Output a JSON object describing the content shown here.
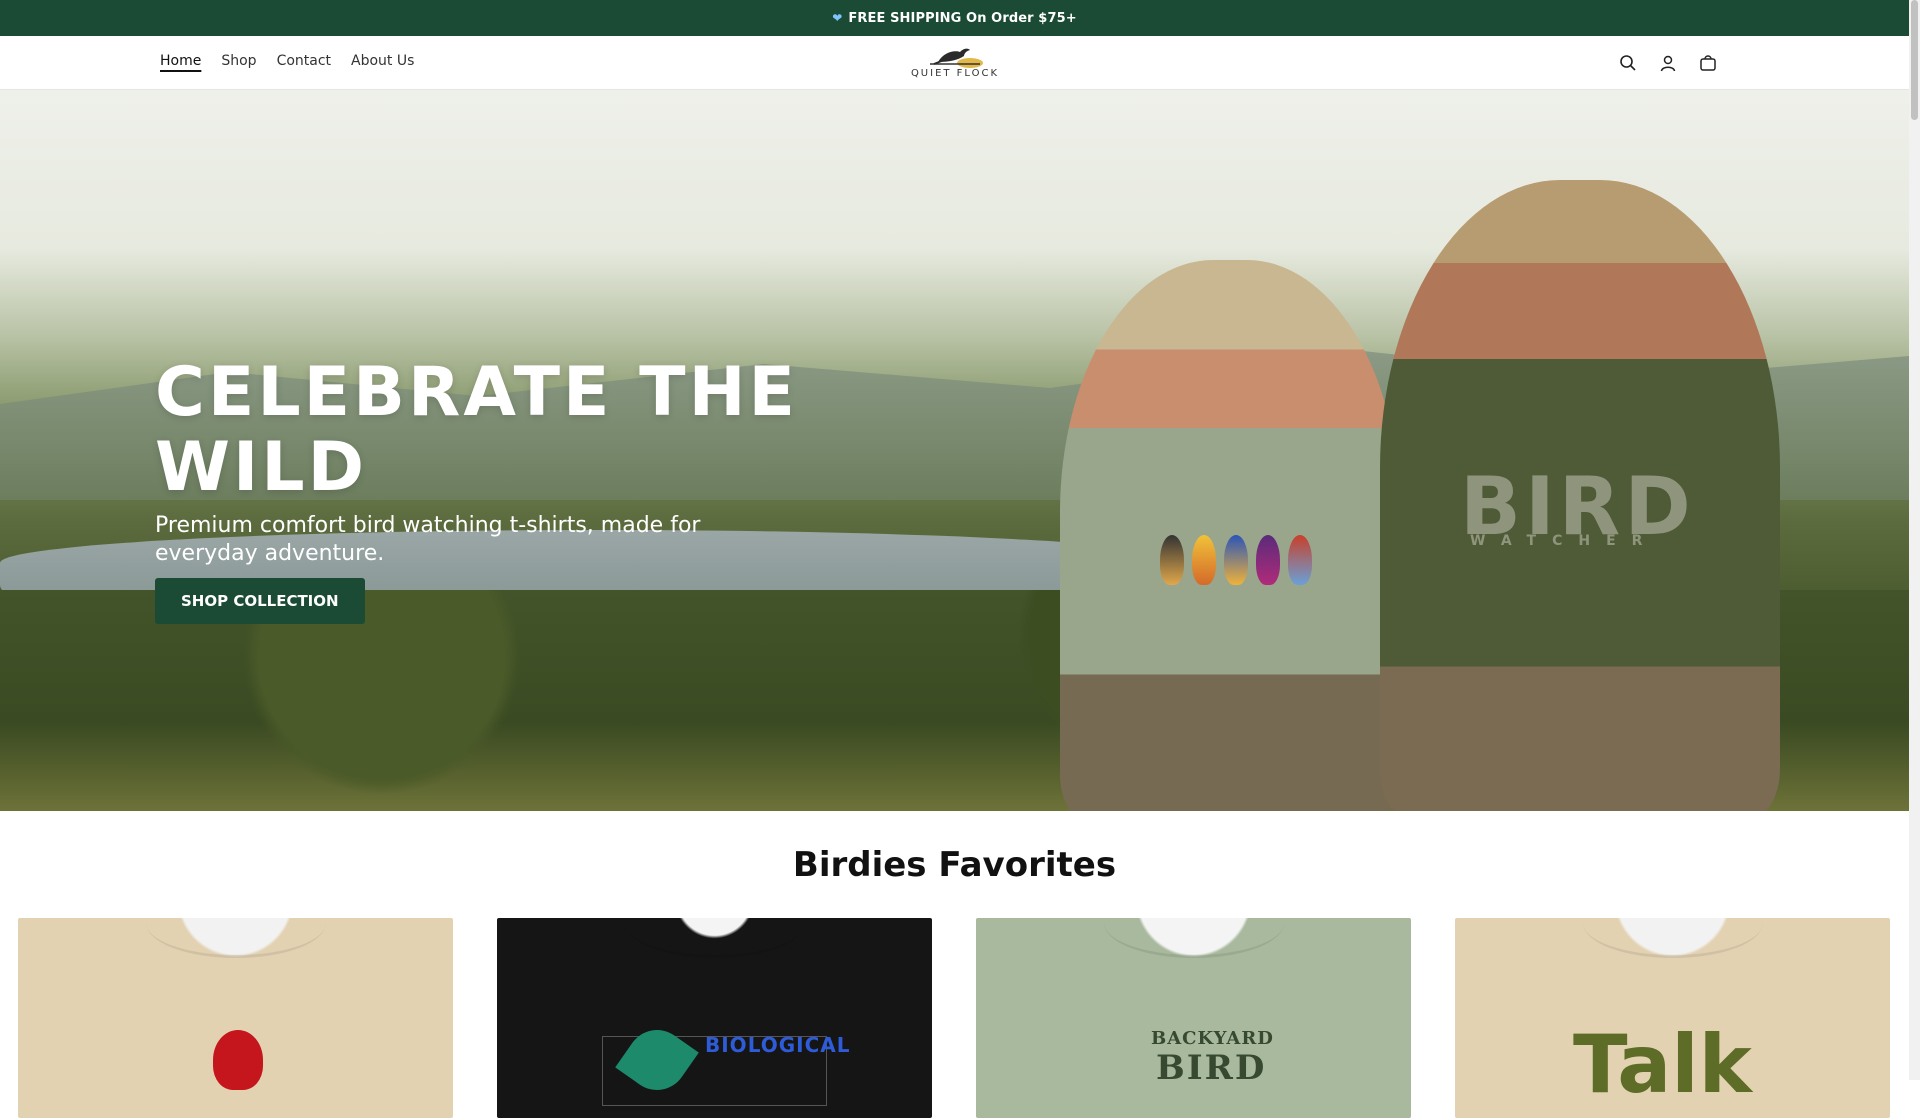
{
  "announcement": {
    "icon": "heart-icon",
    "text": "FREE SHIPPING On Order $75+"
  },
  "nav": [
    {
      "label": "Home",
      "active": true
    },
    {
      "label": "Shop"
    },
    {
      "label": "Contact"
    },
    {
      "label": "About Us"
    }
  ],
  "logo": {
    "text": "QUIET FLOCK"
  },
  "header_icons": [
    "search-icon",
    "account-icon",
    "cart-icon"
  ],
  "hero": {
    "title": "CELEBRATE THE WILD",
    "subtitle": "Premium comfort bird watching t-shirts, made for everyday adventure.",
    "button": "SHOP COLLECTION",
    "shirt_word": "BIRD",
    "shirt_subword": "WATCHER"
  },
  "favorites": {
    "title": "Birdies Favorites",
    "products": [
      {
        "art_text": ""
      },
      {
        "art_text": "BIOLOGICAL"
      },
      {
        "art_text": "BACKYARD",
        "art_text2": "BIRD"
      },
      {
        "art_text": "Talk"
      }
    ]
  },
  "colors": {
    "brand_green": "#1b4b34",
    "link_blue": "#7fc3ff"
  }
}
